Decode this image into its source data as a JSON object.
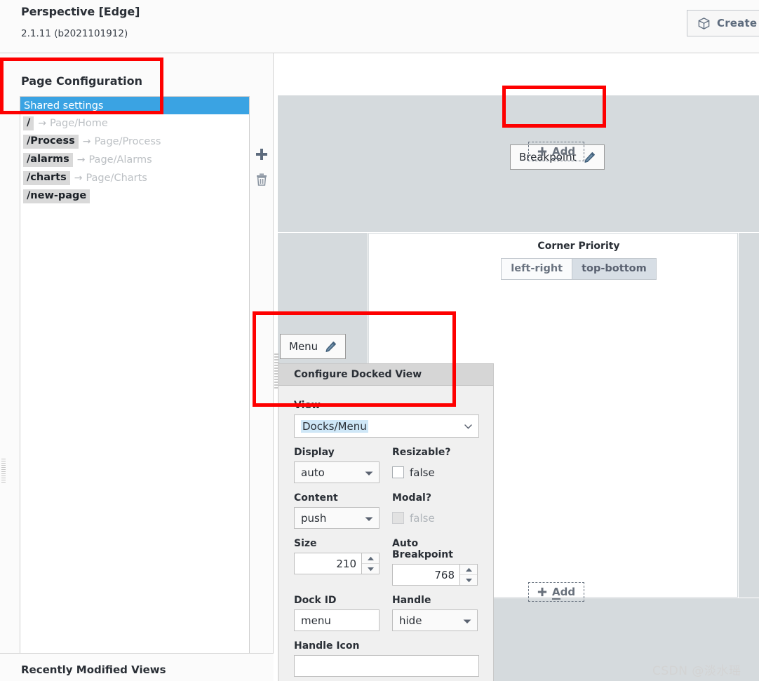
{
  "header": {
    "title": "Perspective [Edge]",
    "version": "2.1.11 (b2021101912)",
    "create_label": "Create",
    "cube_icon": "cube-icon"
  },
  "left_panel": {
    "title": "Page Configuration",
    "selected_row": "Shared settings",
    "pages": [
      {
        "path": "/",
        "arrow": "→",
        "target": "Page/Home"
      },
      {
        "path": "/Process",
        "arrow": "→",
        "target": "Page/Process"
      },
      {
        "path": "/alarms",
        "arrow": "→",
        "target": "Page/Alarms"
      },
      {
        "path": "/charts",
        "arrow": "→",
        "target": "Page/Charts"
      },
      {
        "path": "/new-page",
        "arrow": "",
        "target": ""
      }
    ],
    "tools": {
      "add_icon": "plus-icon",
      "delete_icon": "trash-icon"
    },
    "bottom_title": "Recently Modified Views"
  },
  "canvas": {
    "breakpoint_chip": {
      "label": "Breakpoint",
      "icon": "pencil-icon"
    },
    "menu_chip": {
      "label": "Menu",
      "icon": "pencil-icon"
    },
    "add_top": {
      "label_before": "",
      "label_key": "A",
      "label_after": "dd",
      "icon": "plus-icon"
    },
    "add_bottom": {
      "label_key": "A",
      "label_after": "dd",
      "icon": "plus-icon"
    },
    "corner_priority": {
      "title": "Corner Priority",
      "options": [
        "left-right",
        "top-bottom"
      ],
      "selected": "top-bottom"
    }
  },
  "config_panel": {
    "header": "Configure Docked View",
    "fields": {
      "view": {
        "label": "View",
        "value": "Docks/Menu"
      },
      "display": {
        "label": "Display",
        "value": "auto"
      },
      "resizable": {
        "label": "Resizable?",
        "value": "false",
        "checked": false,
        "disabled": false
      },
      "content": {
        "label": "Content",
        "value": "push"
      },
      "modal": {
        "label": "Modal?",
        "value": "false",
        "checked": false,
        "disabled": true
      },
      "size": {
        "label": "Size",
        "value": "210"
      },
      "auto_breakpoint": {
        "label": "Auto Breakpoint",
        "value": "768"
      },
      "dock_id": {
        "label": "Dock ID",
        "value": "menu"
      },
      "handle": {
        "label": "Handle",
        "value": "hide"
      },
      "handle_icon": {
        "label": "Handle Icon",
        "value": ""
      }
    }
  },
  "annotations": {
    "color": "#fe0000",
    "boxes": [
      "page-configuration",
      "breakpoint",
      "menu-dock"
    ]
  },
  "watermark": "CSDN @淡水瑶"
}
